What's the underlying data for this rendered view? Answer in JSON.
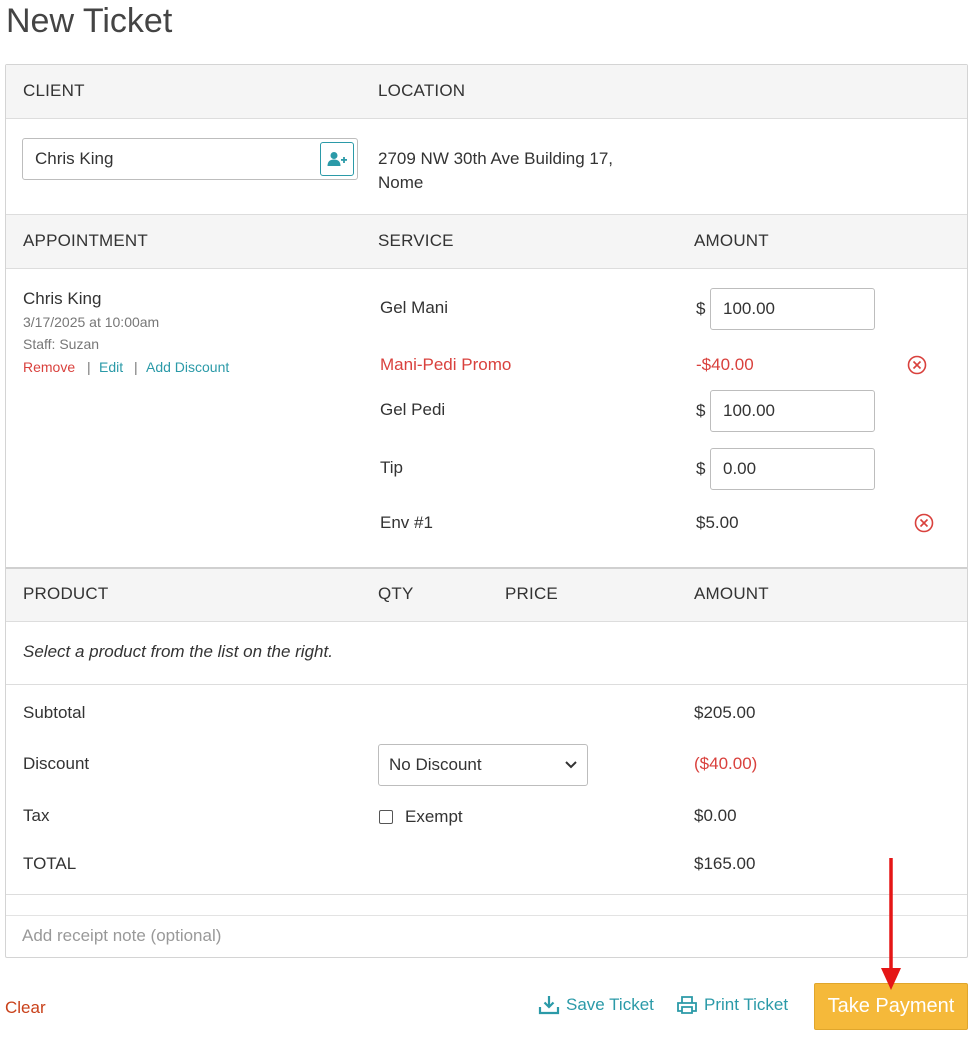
{
  "page": {
    "title": "New Ticket"
  },
  "client_section": {
    "client_header": "CLIENT",
    "location_header": "LOCATION",
    "client_value": "Chris King",
    "location_line1": "2709 NW 30th Ave Building 17,",
    "location_line2": "Nome"
  },
  "appointment_section": {
    "appointment_header": "APPOINTMENT",
    "service_header": "SERVICE",
    "amount_header": "AMOUNT",
    "client_name": "Chris King",
    "datetime": "3/17/2025 at 10:00am",
    "staff": "Staff: Suzan",
    "remove_label": "Remove",
    "edit_label": "Edit",
    "add_discount_label": "Add Discount",
    "separator": "|",
    "currency": "$",
    "services": [
      {
        "name": "Gel Mani",
        "amount": "100.00"
      },
      {
        "name": "Mani-Pedi Promo",
        "amount": "-$40.00"
      },
      {
        "name": "Gel Pedi",
        "amount": "100.00"
      },
      {
        "name": "Tip",
        "amount": "0.00"
      },
      {
        "name": "Env #1",
        "amount": "$5.00"
      }
    ]
  },
  "product_section": {
    "product_header": "PRODUCT",
    "qty_header": "QTY",
    "price_header": "PRICE",
    "amount_header": "AMOUNT",
    "empty_message": "Select a product from the list on the right."
  },
  "totals": {
    "subtotal_label": "Subtotal",
    "subtotal_value": "$205.00",
    "discount_label": "Discount",
    "discount_select": "No Discount",
    "discount_value": "($40.00)",
    "tax_label": "Tax",
    "exempt_label": "Exempt",
    "tax_value": "$0.00",
    "total_label": "TOTAL",
    "total_value": "$165.00"
  },
  "receipt_note": {
    "placeholder": "Add receipt note (optional)"
  },
  "footer": {
    "clear_label": "Clear",
    "save_label": "Save Ticket",
    "print_label": "Print Ticket",
    "pay_label": "Take Payment"
  },
  "icons": {
    "add_client": "user-plus-icon",
    "remove": "circle-x-icon",
    "save": "download-icon",
    "print": "printer-icon",
    "dropdown": "chevron-down-icon",
    "annotation": "red-arrow-annotation"
  },
  "colors": {
    "accent": "#2b9aa8",
    "danger": "#d9413d",
    "primary_button": "#f5b93a",
    "clear": "#c9411a",
    "header_band": "#f5f5f5"
  }
}
